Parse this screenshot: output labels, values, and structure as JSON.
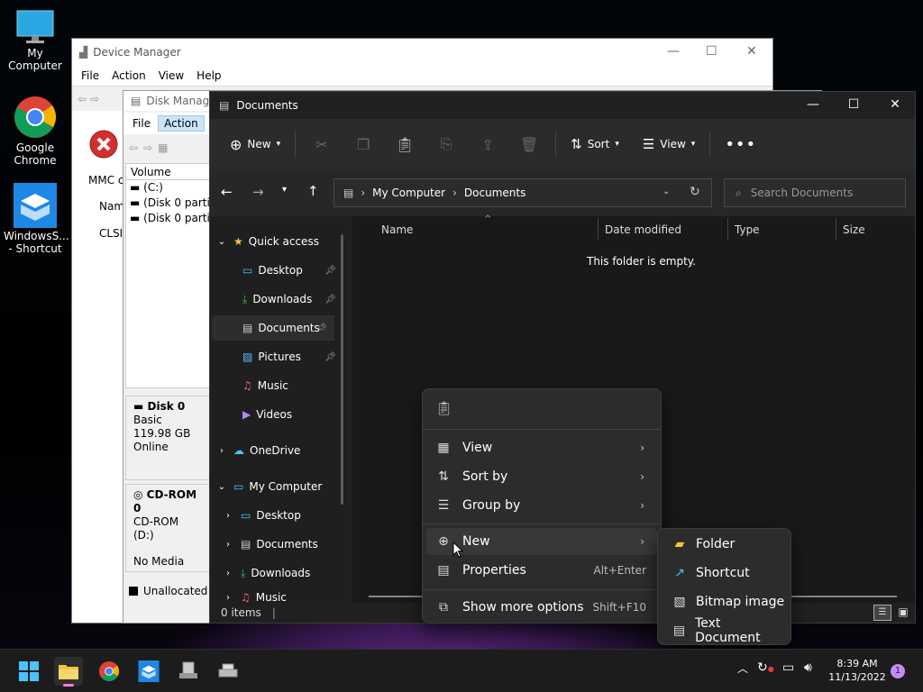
{
  "desktop": {
    "icons": [
      {
        "label": "My Computer",
        "icon": "monitor-icon"
      },
      {
        "label": "Google Chrome",
        "icon": "chrome-icon"
      },
      {
        "label": "WindowsS... - Shortcut",
        "icon": "windows-sandbox-icon"
      }
    ]
  },
  "device_manager": {
    "title": "Device Manager",
    "menu": [
      "File",
      "Action",
      "View",
      "Help"
    ],
    "side_text": [
      "MMC c",
      "Nam",
      "CLSI"
    ]
  },
  "disk_management": {
    "title": "Disk Manage",
    "menu": [
      "File",
      "Action"
    ],
    "column_header": "Volume",
    "volumes": [
      "(C:)",
      "(Disk 0 partiti",
      "(Disk 0 partiti"
    ],
    "disks": [
      {
        "name": "Disk 0",
        "type": "Basic",
        "size": "119.98 GB",
        "status": "Online"
      },
      {
        "name": "CD-ROM 0",
        "type": "CD-ROM (D:)",
        "size": "",
        "status": "No Media"
      }
    ],
    "legend_unallocated": "Unallocated"
  },
  "explorer": {
    "title": "Documents",
    "toolbar": {
      "new": "New",
      "sort": "Sort",
      "view": "View"
    },
    "address": {
      "root": "My Computer",
      "current": "Documents"
    },
    "search_placeholder": "Search Documents",
    "nav": {
      "quick_access": "Quick access",
      "quick_items": [
        "Desktop",
        "Downloads",
        "Documents",
        "Pictures",
        "Music",
        "Videos"
      ],
      "onedrive": "OneDrive",
      "my_computer": "My Computer",
      "pc_items": [
        "Desktop",
        "Documents",
        "Downloads",
        "Music"
      ]
    },
    "columns": [
      "Name",
      "Date modified",
      "Type",
      "Size"
    ],
    "empty_message": "This folder is empty.",
    "status": "0 items"
  },
  "context_menu": {
    "items": [
      {
        "label": "View",
        "shortcut": "",
        "submenu": true
      },
      {
        "label": "Sort by",
        "shortcut": "",
        "submenu": true
      },
      {
        "label": "Group by",
        "shortcut": "",
        "submenu": true
      },
      {
        "label": "New",
        "shortcut": "",
        "submenu": true
      },
      {
        "label": "Properties",
        "shortcut": "Alt+Enter",
        "submenu": false
      },
      {
        "label": "Show more options",
        "shortcut": "Shift+F10",
        "submenu": false
      }
    ]
  },
  "new_submenu": {
    "items": [
      "Folder",
      "Shortcut",
      "Bitmap image",
      "Text Document"
    ]
  },
  "taskbar": {
    "time": "8:39 AM",
    "date": "11/13/2022",
    "notification_count": "1"
  },
  "colors": {
    "accent": "#4cc2ff",
    "folder": "#f4c542",
    "desktop_bg": "#000000"
  }
}
